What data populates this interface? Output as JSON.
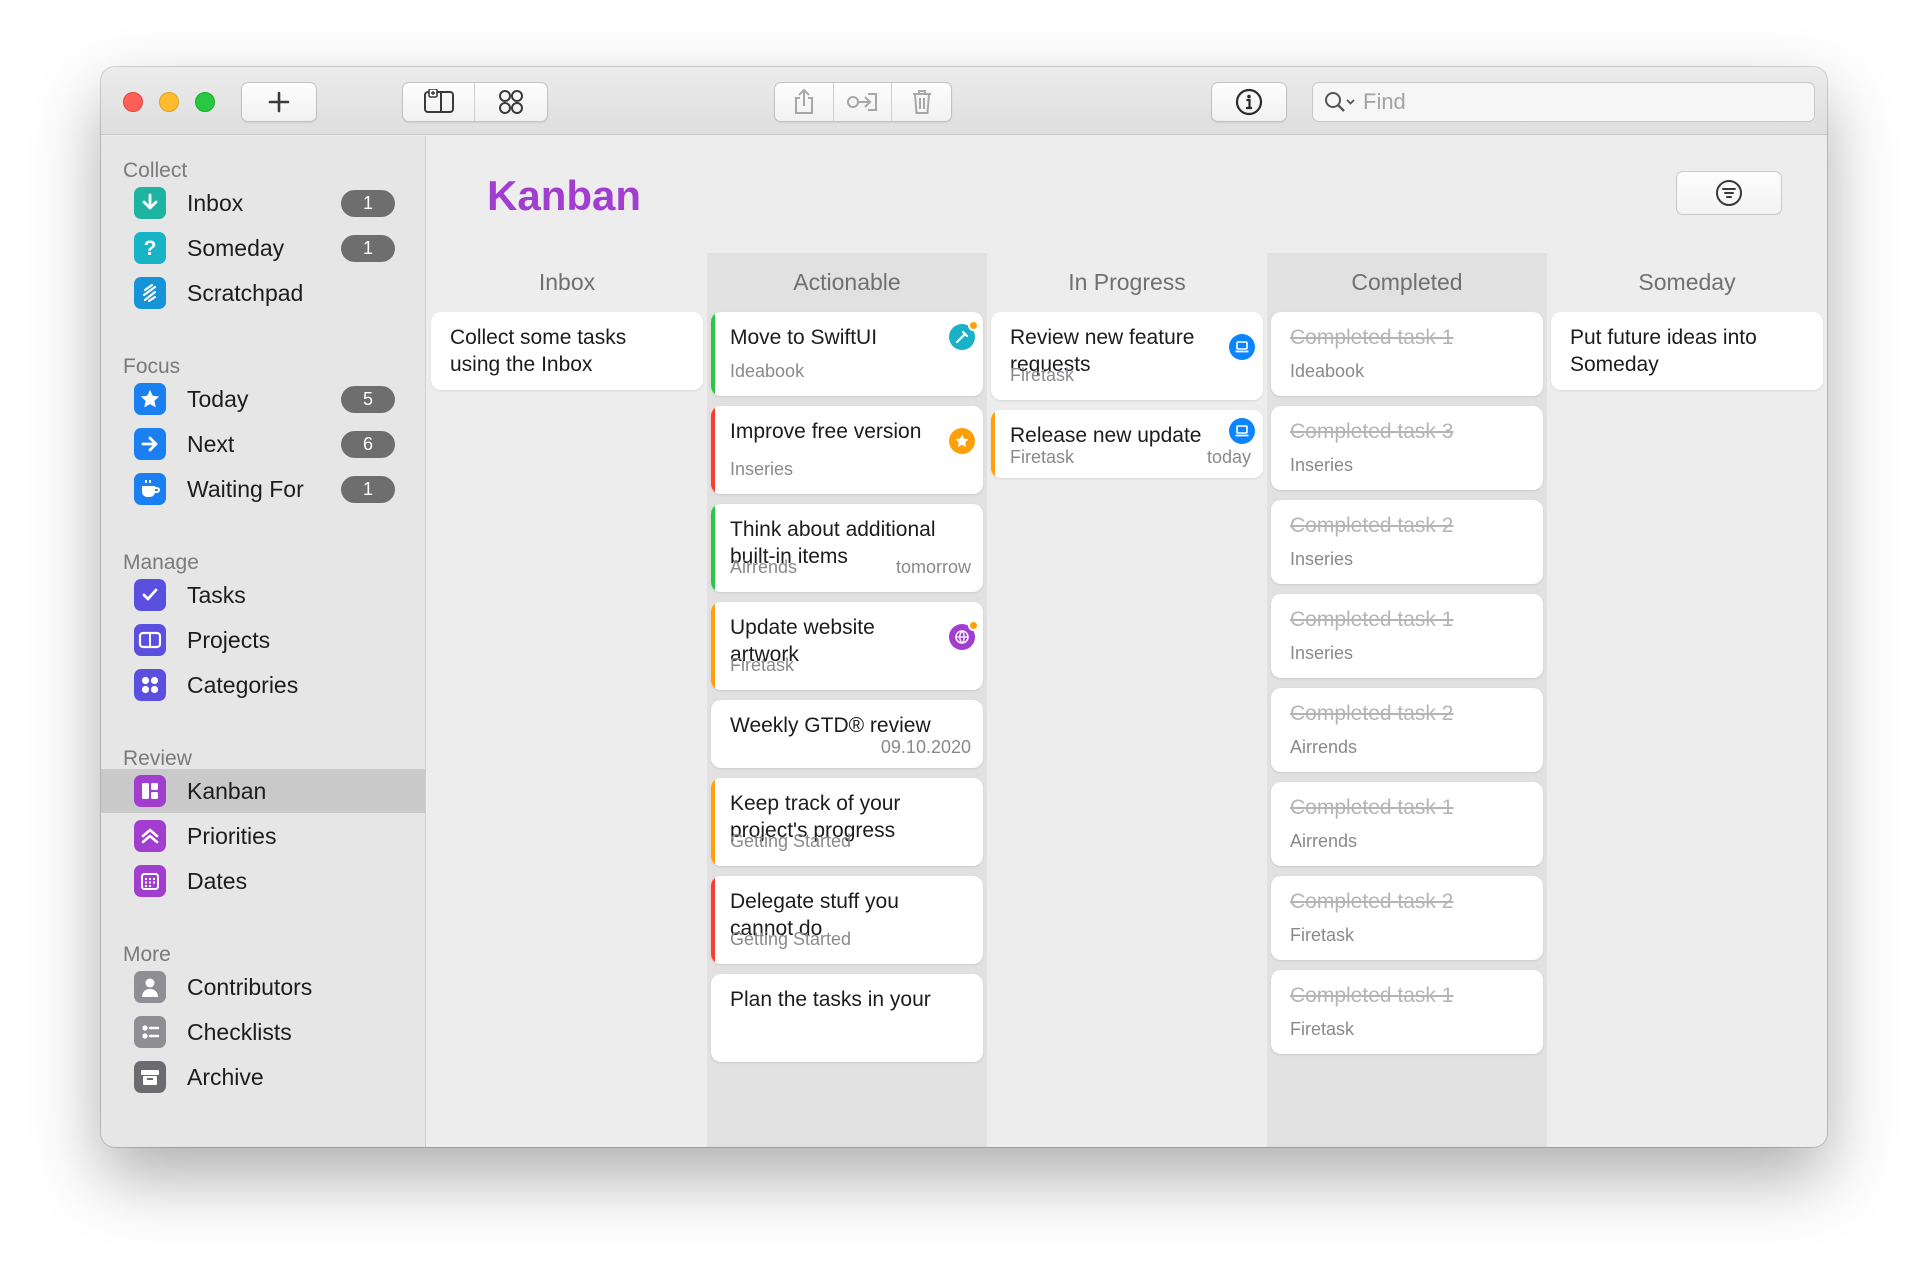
{
  "toolbar": {
    "search_placeholder": "Find",
    "icons": [
      "plus-icon",
      "sidebar-toggle-icon",
      "grid-view-icon",
      "share-icon",
      "move-icon",
      "trash-icon",
      "info-icon",
      "search-icon"
    ]
  },
  "colors": {
    "accent": "#a13ed0",
    "green": "#28c840",
    "red": "#ff3b30",
    "orange": "#ff9f0a",
    "blue": "#0a84ff"
  },
  "sidebar": {
    "sections": {
      "collect": "Collect",
      "focus": "Focus",
      "manage": "Manage",
      "review": "Review",
      "more": "More"
    },
    "items": {
      "inbox": {
        "label": "Inbox",
        "badge": "1",
        "icon": "inbox-arrow-icon"
      },
      "someday": {
        "label": "Someday",
        "badge": "1",
        "icon": "question-icon"
      },
      "scratchpad": {
        "label": "Scratchpad",
        "icon": "scratchpad-icon"
      },
      "today": {
        "label": "Today",
        "badge": "5",
        "icon": "star-icon"
      },
      "next": {
        "label": "Next",
        "badge": "6",
        "icon": "arrow-right-icon"
      },
      "waiting": {
        "label": "Waiting For",
        "badge": "1",
        "icon": "coffee-cup-icon"
      },
      "tasks": {
        "label": "Tasks",
        "icon": "checkbox-icon"
      },
      "projects": {
        "label": "Projects",
        "icon": "projects-icon"
      },
      "categories": {
        "label": "Categories",
        "icon": "categories-icon"
      },
      "kanban": {
        "label": "Kanban",
        "icon": "kanban-icon"
      },
      "priorities": {
        "label": "Priorities",
        "icon": "priorities-icon"
      },
      "dates": {
        "label": "Dates",
        "icon": "calendar-icon"
      },
      "contributors": {
        "label": "Contributors",
        "icon": "person-icon"
      },
      "checklists": {
        "label": "Checklists",
        "icon": "checklist-icon"
      },
      "archive": {
        "label": "Archive",
        "icon": "archive-box-icon"
      }
    }
  },
  "main": {
    "title": "Kanban",
    "columns": {
      "inbox": {
        "title": "Inbox",
        "cards": [
          {
            "title": "Collect some tasks using the Inbox"
          }
        ]
      },
      "actionable": {
        "title": "Actionable",
        "cards": [
          {
            "title": "Move to SwiftUI",
            "project": "Ideabook",
            "icon": "tools-icon"
          },
          {
            "title": "Improve free version",
            "project": "Inseries",
            "icon": "star-icon"
          },
          {
            "title": "Think about additional built-in items",
            "project": "Airrends",
            "due": "tomorrow"
          },
          {
            "title": "Update website artwork",
            "project": "Firetask",
            "icon": "globe-icon"
          },
          {
            "title": "Weekly GTD® review",
            "due": "09.10.2020"
          },
          {
            "title": "Keep track of your project's progress",
            "project": "Getting Started"
          },
          {
            "title": "Delegate stuff you cannot do",
            "project": "Getting Started"
          },
          {
            "title": "Plan the tasks in your"
          }
        ]
      },
      "in_progress": {
        "title": "In Progress",
        "cards": [
          {
            "title": "Review new feature requests",
            "project": "Firetask",
            "icon": "laptop-icon"
          },
          {
            "title": "Release new update",
            "project": "Firetask",
            "due": "today",
            "icon": "laptop-icon"
          }
        ]
      },
      "completed": {
        "title": "Completed",
        "cards": [
          {
            "title": "Completed task 1",
            "project": "Ideabook"
          },
          {
            "title": "Completed task 3",
            "project": "Inseries"
          },
          {
            "title": "Completed task 2",
            "project": "Inseries"
          },
          {
            "title": "Completed task 1",
            "project": "Inseries"
          },
          {
            "title": "Completed task 2",
            "project": "Airrends"
          },
          {
            "title": "Completed task 1",
            "project": "Airrends"
          },
          {
            "title": "Completed task 2",
            "project": "Firetask"
          },
          {
            "title": "Completed task 1",
            "project": "Firetask"
          }
        ]
      },
      "someday": {
        "title": "Someday",
        "cards": [
          {
            "title": "Put future ideas into Someday"
          }
        ]
      }
    }
  }
}
